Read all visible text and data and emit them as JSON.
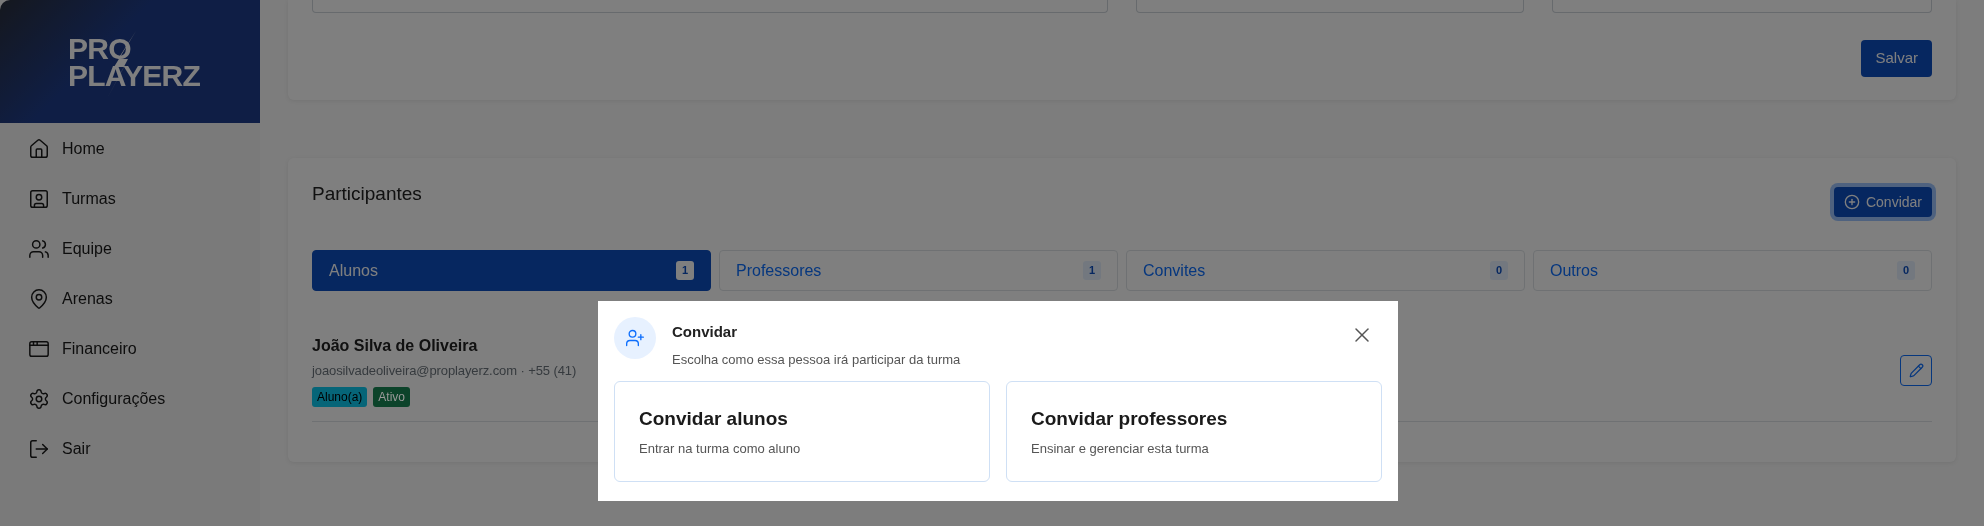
{
  "sidebar": {
    "logo": [
      "PRO",
      "PLAYERZ"
    ],
    "items": [
      {
        "label": "Home"
      },
      {
        "label": "Turmas"
      },
      {
        "label": "Equipe"
      },
      {
        "label": "Arenas"
      },
      {
        "label": "Financeiro"
      },
      {
        "label": "Configurações"
      },
      {
        "label": "Sair"
      }
    ]
  },
  "top_card": {
    "save_button": "Salvar"
  },
  "participants": {
    "title": "Participantes",
    "invite_button": "Convidar",
    "tabs": [
      {
        "label": "Alunos",
        "count": "1",
        "selected": true
      },
      {
        "label": "Professores",
        "count": "1",
        "selected": false
      },
      {
        "label": "Convites",
        "count": "0",
        "selected": false
      },
      {
        "label": "Outros",
        "count": "0",
        "selected": false
      }
    ],
    "rows": [
      {
        "name": "João Silva de Oliveira",
        "contact": "joaosilvadeoliveira@proplayerz.com · +55 (41)",
        "tags": [
          {
            "label": "Aluno(a)",
            "color": "#066578"
          },
          {
            "label": "Ativo",
            "color": "#0c432a"
          }
        ]
      }
    ]
  },
  "modal": {
    "title": "Convidar",
    "subtitle": "Escolha como essa pessoa irá participar da turma",
    "options": [
      {
        "title": "Convidar alunos",
        "description": "Entrar na turma como aluno"
      },
      {
        "title": "Convidar professores",
        "description": "Ensinar e gerenciar esta turma"
      }
    ]
  }
}
